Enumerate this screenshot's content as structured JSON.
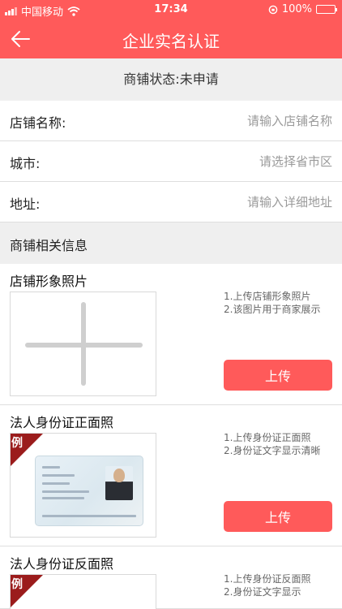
{
  "status_bar": {
    "carrier": "中国移动",
    "time": "17:34",
    "battery": "100%"
  },
  "nav": {
    "title": "企业实名认证"
  },
  "shop_status": "商铺状态:未申请",
  "form": {
    "name_label": "店铺名称:",
    "name_placeholder": "请输入店铺名称",
    "city_label": "城市:",
    "city_placeholder": "请选择省市区",
    "address_label": "地址:",
    "address_placeholder": "请输入详细地址"
  },
  "section_title": "商铺相关信息",
  "uploads": [
    {
      "title": "店铺形象照片",
      "note1": "1.上传店铺形象照片",
      "note2": "2.该图片用于商家展示",
      "button": "上传"
    },
    {
      "title": "法人身份证正面照",
      "badge": "例",
      "note1": "1.上传身份证正面照",
      "note2": "2.身份证文字显示清晰",
      "button": "上传"
    },
    {
      "title": "法人身份证反面照",
      "badge": "例",
      "note1": "1.上传身份证反面照",
      "note2": "2.身份证文字显示"
    }
  ]
}
